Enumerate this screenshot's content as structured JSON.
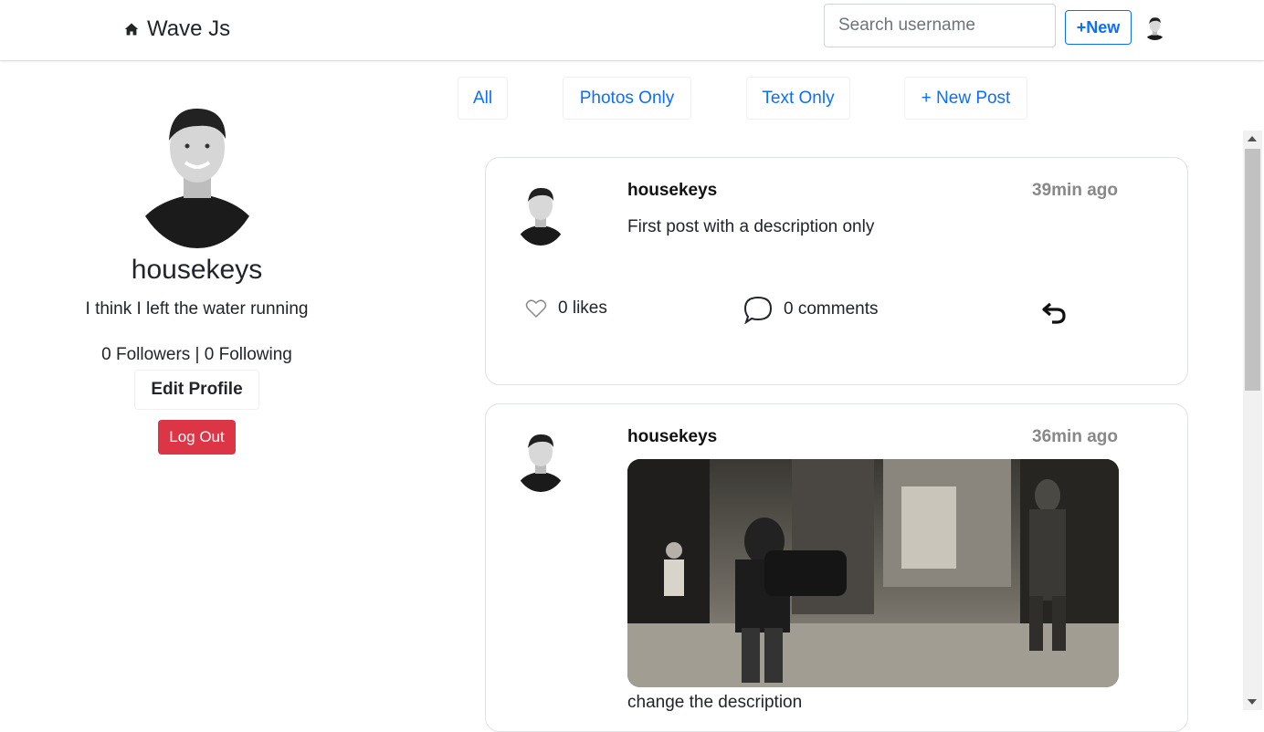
{
  "nav": {
    "brand": "Wave Js",
    "search_placeholder": "Search username",
    "new_label": "+New"
  },
  "profile": {
    "username": "housekeys",
    "bio": "I think I left the water running",
    "follow_text": "0 Followers | 0 Following",
    "edit_label": "Edit Profile",
    "logout_label": "Log Out"
  },
  "tabs": [
    {
      "label": "All"
    },
    {
      "label": "Photos Only"
    },
    {
      "label": "Text Only"
    },
    {
      "label": "+ New Post"
    }
  ],
  "posts": [
    {
      "username": "housekeys",
      "time": "39min ago",
      "description": "First post with a description only",
      "likes": "0 likes",
      "comments": "0 comments"
    },
    {
      "username": "housekeys",
      "time": "36min ago",
      "description": "change the description"
    }
  ],
  "colors": {
    "primary": "#0d6efd",
    "danger": "#dc3545",
    "muted": "#888888"
  }
}
